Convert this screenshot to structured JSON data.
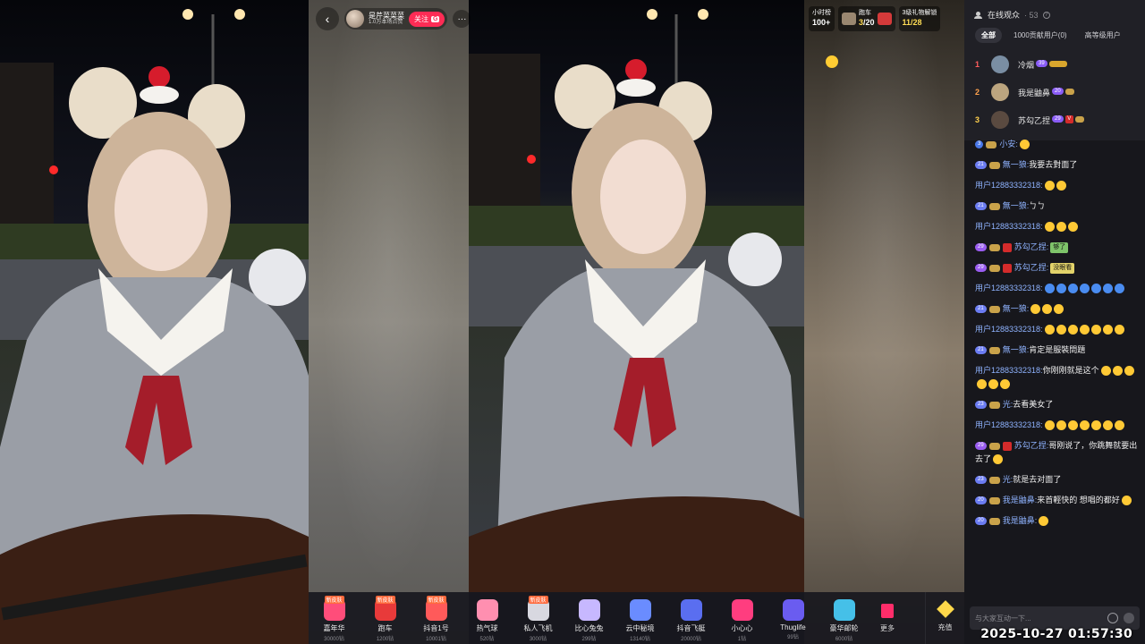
{
  "host": {
    "name": "是芹菜菜菜",
    "subtitle": "1.0万本场点赞",
    "follow_label": "关注",
    "follow_badge": "G"
  },
  "ranks": [
    {
      "title": "小时榜",
      "value": "100+"
    },
    {
      "title": "跑车",
      "value": "3",
      "total": "/20"
    },
    {
      "title": "3级礼物解锁",
      "value": "11/28"
    }
  ],
  "gifts": [
    {
      "name": "嘉年华",
      "price": "30000钻",
      "tag": "新皮肤",
      "color": "#ff4d7a"
    },
    {
      "name": "跑车",
      "price": "1200钻",
      "tag": "新皮肤",
      "color": "#e83a3a"
    },
    {
      "name": "抖音1号",
      "price": "10001钻",
      "tag": "新皮肤",
      "color": "#ff5a5a"
    },
    {
      "name": "热气球",
      "price": "520钻",
      "tag": "",
      "color": "#ff8fb0"
    },
    {
      "name": "私人飞机",
      "price": "3000钻",
      "tag": "新皮肤",
      "color": "#d8d8e0"
    },
    {
      "name": "比心兔兔",
      "price": "299钻",
      "tag": "",
      "color": "#c7b8ff"
    },
    {
      "name": "云中秘境",
      "price": "13140钻",
      "tag": "",
      "color": "#6a8cff"
    },
    {
      "name": "抖音飞艇",
      "price": "20000钻",
      "tag": "",
      "color": "#5a6ef0"
    },
    {
      "name": "小心心",
      "price": "1钻",
      "tag": "",
      "color": "#ff3d7f"
    },
    {
      "name": "Thuglife",
      "price": "99钻",
      "tag": "",
      "color": "#6a5cf0"
    },
    {
      "name": "豪华邮轮",
      "price": "6000钻",
      "tag": "",
      "color": "#45c0e8"
    }
  ],
  "gift_more_label": "更多",
  "recharge_label": "充值",
  "audience": {
    "title": "在线观众",
    "count": "· 53",
    "tabs": [
      "全部",
      "1000贡献用户(0)",
      "高等级用户"
    ]
  },
  "top_users": [
    {
      "rank": "1",
      "name": "冷烟",
      "level": "39",
      "rank_color": "#ff5d5d",
      "avatar": "#7a8ea3"
    },
    {
      "rank": "2",
      "name": "我是鼬鼻",
      "level": "20",
      "rank_color": "#ffa24d",
      "avatar": "#bca57f"
    },
    {
      "rank": "3",
      "name": "苏勾乙捏",
      "level": "29",
      "rank_color": "#ffd04d",
      "avatar": "#5a4a40"
    }
  ],
  "chat": [
    {
      "level": "3",
      "user": "小安:",
      "text": "",
      "emojis": 1
    },
    {
      "level": "21",
      "user": "無一狼:",
      "text": "我要去對面了",
      "emojis": 0
    },
    {
      "level": "",
      "user": "用户12883332318:",
      "text": "",
      "emojis": 2
    },
    {
      "level": "21",
      "user": "無一狼:",
      "text": "ㄅㄅ",
      "emojis": 0
    },
    {
      "level": "",
      "user": "用户12883332318:",
      "text": "",
      "emojis": 3
    },
    {
      "level": "29",
      "user": "苏勾乙捏:",
      "text": "",
      "emojis": 0,
      "sticker": "够了"
    },
    {
      "level": "29",
      "user": "苏勾乙捏:",
      "text": "",
      "emojis": 0,
      "sticker": "没眼看"
    },
    {
      "level": "",
      "user": "用户12883332318:",
      "text": "",
      "emojis": 7,
      "blue": true
    },
    {
      "level": "21",
      "user": "無一狼:",
      "text": "",
      "emojis": 3
    },
    {
      "level": "",
      "user": "用户12883332318:",
      "text": "",
      "emojis": 7
    },
    {
      "level": "21",
      "user": "無一狼:",
      "text": "肯定是服裝問題",
      "emojis": 0
    },
    {
      "level": "",
      "user": "用户12883332318:",
      "text": "你刚刚就是这个",
      "emojis": 6
    },
    {
      "level": "23",
      "user": "光:",
      "text": "去看美女了",
      "emojis": 0
    },
    {
      "level": "",
      "user": "用户12883332318:",
      "text": "",
      "emojis": 7
    },
    {
      "level": "29",
      "user": "苏勾乙捏:",
      "text": "哥刚说了，你跳舞就要出去了",
      "emojis": 1
    },
    {
      "level": "23",
      "user": "光:",
      "text": "就是去对面了",
      "emojis": 0
    },
    {
      "level": "20",
      "user": "我是鼬鼻:",
      "text": "来首輕快的 想唱的都好",
      "emojis": 1
    },
    {
      "level": "20",
      "user": "我是鼬鼻:",
      "text": "",
      "emojis": 1
    }
  ],
  "chat_input_placeholder": "与大家互动一下...",
  "timestamp": "2025-10-27 01:57:30"
}
